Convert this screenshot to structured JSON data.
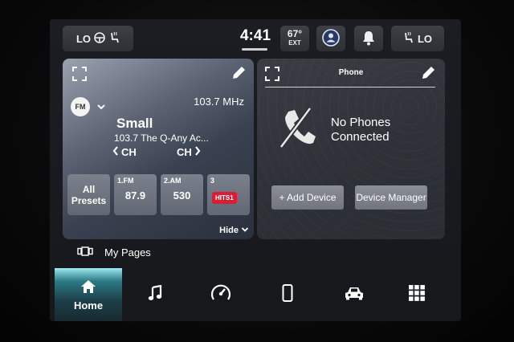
{
  "status_bar": {
    "left_climate": {
      "label": "LO",
      "icon": "heated-seat-icon"
    },
    "time": "4:41",
    "temperature": {
      "value": "67°",
      "label": "EXT"
    },
    "profile_icon": "driver-profile-icon",
    "notifications_icon": "bell-icon",
    "right_climate": {
      "label": "LO",
      "icon": "heated-seat-icon"
    }
  },
  "radio": {
    "band_badge": "FM",
    "frequency": "103.7 MHz",
    "station_name": "Small",
    "song_info": "103.7 The Q-Any Ac...",
    "ch_prev_label": "CH",
    "ch_next_label": "CH",
    "all_presets_label": "All Presets",
    "presets": [
      {
        "label": "1.FM",
        "value": "87.9"
      },
      {
        "label": "2.AM",
        "value": "530"
      },
      {
        "label": "3",
        "logo_text": "HITS1"
      }
    ],
    "hide_label": "Hide"
  },
  "phone": {
    "title": "Phone",
    "status_line1": "No Phones",
    "status_line2": "Connected",
    "add_device_label": "+ Add Device",
    "device_manager_label": "Device Manager"
  },
  "my_pages": {
    "label": "My Pages"
  },
  "bottom_nav": {
    "home_label": "Home",
    "items": [
      "home-icon",
      "music-note-icon",
      "gauge-icon",
      "smartphone-icon",
      "car-icon",
      "apps-grid-icon"
    ]
  },
  "colors": {
    "accent_teal": "#2c7b86",
    "hits_logo_red": "#d91d35"
  }
}
